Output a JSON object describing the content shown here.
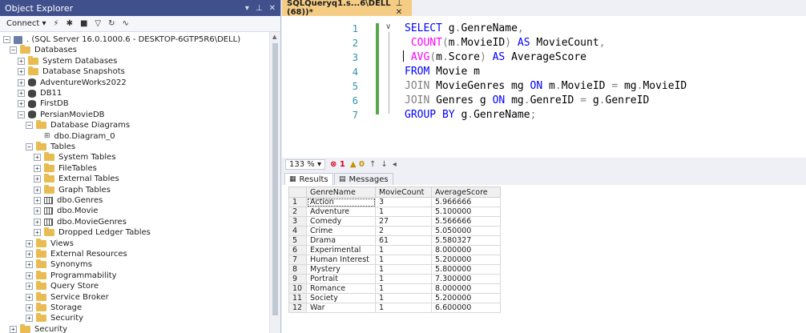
{
  "object_explorer": {
    "title": "Object Explorer",
    "title_controls": [
      "▾",
      "⊥",
      "✕"
    ],
    "toolbar": {
      "connect_label": "Connect ▾",
      "icons": [
        "plug-icon",
        "disconnect-icon",
        "stop-icon",
        "filter-icon",
        "refresh-icon",
        "activity-icon"
      ]
    },
    "tree": [
      {
        "id": "server",
        "label": ". (SQL Server 16.0.1000.6 - DESKTOP-6GTP5R6\\DELL)",
        "icon": "server",
        "exp": "−"
      },
      {
        "id": "databases",
        "label": "Databases",
        "icon": "folder",
        "exp": "−"
      },
      {
        "id": "system-databases",
        "label": "System Databases",
        "icon": "folder",
        "exp": "+"
      },
      {
        "id": "database-snapshots",
        "label": "Database Snapshots",
        "icon": "folder",
        "exp": "+"
      },
      {
        "id": "adventureworks2022",
        "label": "AdventureWorks2022",
        "icon": "db",
        "exp": "+"
      },
      {
        "id": "db11",
        "label": "DB11",
        "icon": "db",
        "exp": "+"
      },
      {
        "id": "firstdb",
        "label": "FirstDB",
        "icon": "db",
        "exp": "+"
      },
      {
        "id": "persianmoviedb",
        "label": "PersianMovieDB",
        "icon": "db",
        "exp": "−"
      },
      {
        "id": "database-diagrams",
        "label": "Database Diagrams",
        "icon": "folder",
        "exp": "−"
      },
      {
        "id": "dbo-diagram-0",
        "label": "dbo.Diagram_0",
        "icon": "diagram",
        "exp": ""
      },
      {
        "id": "tables",
        "label": "Tables",
        "icon": "folder",
        "exp": "−"
      },
      {
        "id": "system-tables",
        "label": "System Tables",
        "icon": "folder",
        "exp": "+"
      },
      {
        "id": "filetables",
        "label": "FileTables",
        "icon": "folder",
        "exp": "+"
      },
      {
        "id": "external-tables",
        "label": "External Tables",
        "icon": "folder",
        "exp": "+"
      },
      {
        "id": "graph-tables",
        "label": "Graph Tables",
        "icon": "folder",
        "exp": "+"
      },
      {
        "id": "dbo-genres",
        "label": "dbo.Genres",
        "icon": "table",
        "exp": "+"
      },
      {
        "id": "dbo-movie",
        "label": "dbo.Movie",
        "icon": "table",
        "exp": "+"
      },
      {
        "id": "dbo-moviegenres",
        "label": "dbo.MovieGenres",
        "icon": "table",
        "exp": "+"
      },
      {
        "id": "dropped-ledger-tables",
        "label": "Dropped Ledger Tables",
        "icon": "folder",
        "exp": "+"
      },
      {
        "id": "views",
        "label": "Views",
        "icon": "folder",
        "exp": "+"
      },
      {
        "id": "external-resources",
        "label": "External Resources",
        "icon": "folder",
        "exp": "+"
      },
      {
        "id": "synonyms",
        "label": "Synonyms",
        "icon": "folder",
        "exp": "+"
      },
      {
        "id": "programmability",
        "label": "Programmability",
        "icon": "folder",
        "exp": "+"
      },
      {
        "id": "query-store",
        "label": "Query Store",
        "icon": "folder",
        "exp": "+"
      },
      {
        "id": "service-broker",
        "label": "Service Broker",
        "icon": "folder",
        "exp": "+"
      },
      {
        "id": "storage",
        "label": "Storage",
        "icon": "folder",
        "exp": "+"
      },
      {
        "id": "security-db",
        "label": "Security",
        "icon": "folder",
        "exp": "+"
      },
      {
        "id": "security",
        "label": "Security",
        "icon": "folder",
        "exp": "+"
      }
    ]
  },
  "editor": {
    "tab_title": "SQLQueryq1.s...6\\DELL (68))*",
    "tab_controls": "⊥ ✕",
    "lines": [
      [
        {
          "t": "SELECT ",
          "c": "kw"
        },
        {
          "t": "g",
          "c": ""
        },
        {
          "t": ".",
          "c": "op"
        },
        {
          "t": "GenreName",
          "c": ""
        },
        {
          "t": ",",
          "c": "op"
        }
      ],
      [
        {
          "t": " COUNT",
          "c": "fn"
        },
        {
          "t": "(",
          "c": "op"
        },
        {
          "t": "m",
          "c": ""
        },
        {
          "t": ".",
          "c": "op"
        },
        {
          "t": "MovieID",
          "c": ""
        },
        {
          "t": ") ",
          "c": "op"
        },
        {
          "t": "AS ",
          "c": "kw"
        },
        {
          "t": "MovieCount",
          "c": ""
        },
        {
          "t": ",",
          "c": "op"
        }
      ],
      [
        {
          "t": " AVG",
          "c": "fn"
        },
        {
          "t": "(",
          "c": "op"
        },
        {
          "t": "m",
          "c": ""
        },
        {
          "t": ".",
          "c": "op"
        },
        {
          "t": "Score",
          "c": ""
        },
        {
          "t": ") ",
          "c": "op"
        },
        {
          "t": "AS ",
          "c": "kw"
        },
        {
          "t": "AverageScore",
          "c": ""
        }
      ],
      [
        {
          "t": "FROM ",
          "c": "kw"
        },
        {
          "t": "Movie m",
          "c": ""
        }
      ],
      [
        {
          "t": "JOIN ",
          "c": "op"
        },
        {
          "t": "MovieGenres mg ",
          "c": ""
        },
        {
          "t": "ON ",
          "c": "kw"
        },
        {
          "t": "m",
          "c": ""
        },
        {
          "t": ".",
          "c": "op"
        },
        {
          "t": "MovieID ",
          "c": ""
        },
        {
          "t": "= ",
          "c": "op"
        },
        {
          "t": "mg",
          "c": ""
        },
        {
          "t": ".",
          "c": "op"
        },
        {
          "t": "MovieID",
          "c": ""
        }
      ],
      [
        {
          "t": "JOIN ",
          "c": "op"
        },
        {
          "t": "Genres g ",
          "c": ""
        },
        {
          "t": "ON ",
          "c": "kw"
        },
        {
          "t": "mg",
          "c": ""
        },
        {
          "t": ".",
          "c": "op"
        },
        {
          "t": "GenreID ",
          "c": ""
        },
        {
          "t": "= ",
          "c": "op"
        },
        {
          "t": "g",
          "c": ""
        },
        {
          "t": ".",
          "c": "op"
        },
        {
          "t": "GenreID",
          "c": ""
        }
      ],
      [
        {
          "t": "GROUP BY ",
          "c": "kw"
        },
        {
          "t": "g",
          "c": ""
        },
        {
          "t": ".",
          "c": "op"
        },
        {
          "t": "GenreName",
          "c": ""
        },
        {
          "t": ";",
          "c": "op"
        }
      ]
    ],
    "line_numbers": [
      "1",
      "2",
      "3",
      "4",
      "5",
      "6",
      "7"
    ]
  },
  "status": {
    "zoom": "133 %",
    "zoom_arrow": "▾",
    "errors": "⊗ 1",
    "warnings": "▲ 0",
    "nav_up": "↑",
    "nav_down": "↓",
    "nav_left": "◂"
  },
  "results": {
    "tab_results": "Results",
    "tab_messages": "Messages",
    "columns": [
      "GenreName",
      "MovieCount",
      "AverageScore"
    ],
    "rows": [
      [
        "1",
        "Action",
        "3",
        "5.966666"
      ],
      [
        "2",
        "Adventure",
        "1",
        "5.100000"
      ],
      [
        "3",
        "Comedy",
        "27",
        "5.566666"
      ],
      [
        "4",
        "Crime",
        "2",
        "5.050000"
      ],
      [
        "5",
        "Drama",
        "61",
        "5.580327"
      ],
      [
        "6",
        "Experimental",
        "1",
        "8.000000"
      ],
      [
        "7",
        "Human Interest",
        "1",
        "5.200000"
      ],
      [
        "8",
        "Mystery",
        "1",
        "5.800000"
      ],
      [
        "9",
        "Portrait",
        "1",
        "7.300000"
      ],
      [
        "10",
        "Romance",
        "1",
        "8.000000"
      ],
      [
        "11",
        "Society",
        "1",
        "5.200000"
      ],
      [
        "12",
        "War",
        "1",
        "6.600000"
      ]
    ]
  }
}
